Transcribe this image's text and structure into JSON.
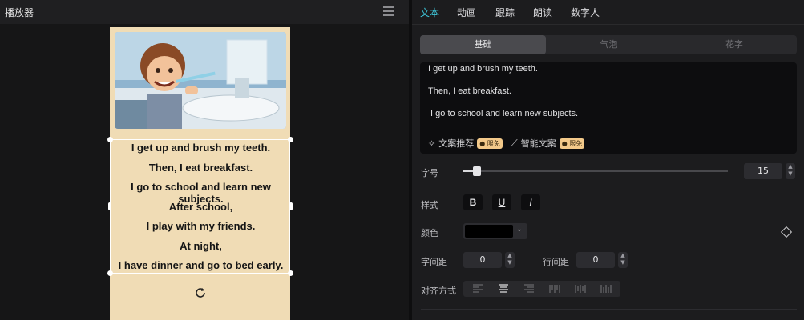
{
  "player": {
    "title": "播放器",
    "card_lines": [
      "I get up and brush my teeth.",
      "Then, I eat breakfast.",
      "I go to school and learn new subjects.",
      "After school,",
      "I play with my friends.",
      "At night,",
      "I have dinner and go to bed early."
    ]
  },
  "tabs": [
    "文本",
    "动画",
    "跟踪",
    "朗读",
    "数字人"
  ],
  "segments": [
    "基础",
    "气泡",
    "花字"
  ],
  "editor": {
    "lines": [
      "I get up and brush my teeth.",
      "Then, I eat breakfast.",
      " I go to school and learn new subjects."
    ],
    "copy_recommend": "文案推荐",
    "smart_copy": "智能文案",
    "badge": "限免"
  },
  "props": {
    "font_size_label": "字号",
    "font_size_value": "15",
    "font_size_fraction": 0.05,
    "style_label": "样式",
    "bold": "B",
    "underline": "U",
    "italic": "I",
    "color_label": "颜色",
    "color_value": "#000000",
    "letter_spacing_label": "字间距",
    "letter_spacing_value": "0",
    "line_spacing_label": "行间距",
    "line_spacing_value": "0",
    "align_label": "对齐方式"
  },
  "colors": {
    "accent": "#3ec5d8",
    "card": "#f0dcb5",
    "badge": "#f3c98a"
  }
}
